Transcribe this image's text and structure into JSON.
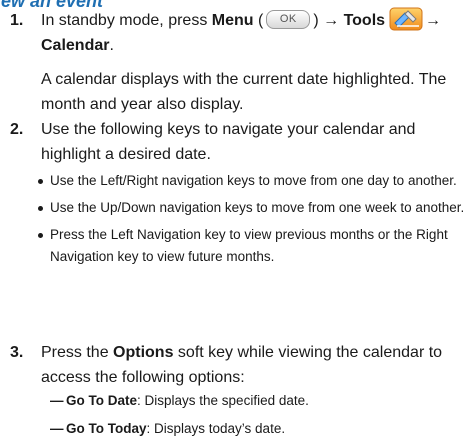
{
  "heading": "iew an event",
  "step1": {
    "number": "1.",
    "text_before": "In standby mode, press ",
    "menu_label": "Menu",
    "paren_open": " (",
    "ok_key": "OK",
    "paren_close": ") ",
    "arrow1": "→",
    "tools_label": "Tools",
    "arrow2": "→",
    "calendar_label": "Calendar",
    "period": ".",
    "follow_text": "A calendar displays with the current date highlighted. The month and year also display."
  },
  "step2": {
    "number": "2.",
    "text": "Use the following keys to navigate your calendar and highlight a desired date.",
    "bullets": [
      "Use the Left/Right navigation keys to move from one day to another.",
      "Use the Up/Down navigation keys to move from one week to another.",
      "Press the Left Navigation key to view previous months or the Right Navigation key to view future months."
    ]
  },
  "step3": {
    "number": "3.",
    "text_before": "Press the ",
    "options_label": "Options",
    "text_after": " soft key while viewing the calendar to access the following options:",
    "dash": "—",
    "options": [
      {
        "name": "Go To Date",
        "desc": ": Displays the specified date."
      },
      {
        "name": "Go To Today",
        "desc": ": Displays today’s date."
      }
    ]
  },
  "icons": {
    "tools": "tools-icon",
    "ok_key": "ok-key-icon"
  }
}
